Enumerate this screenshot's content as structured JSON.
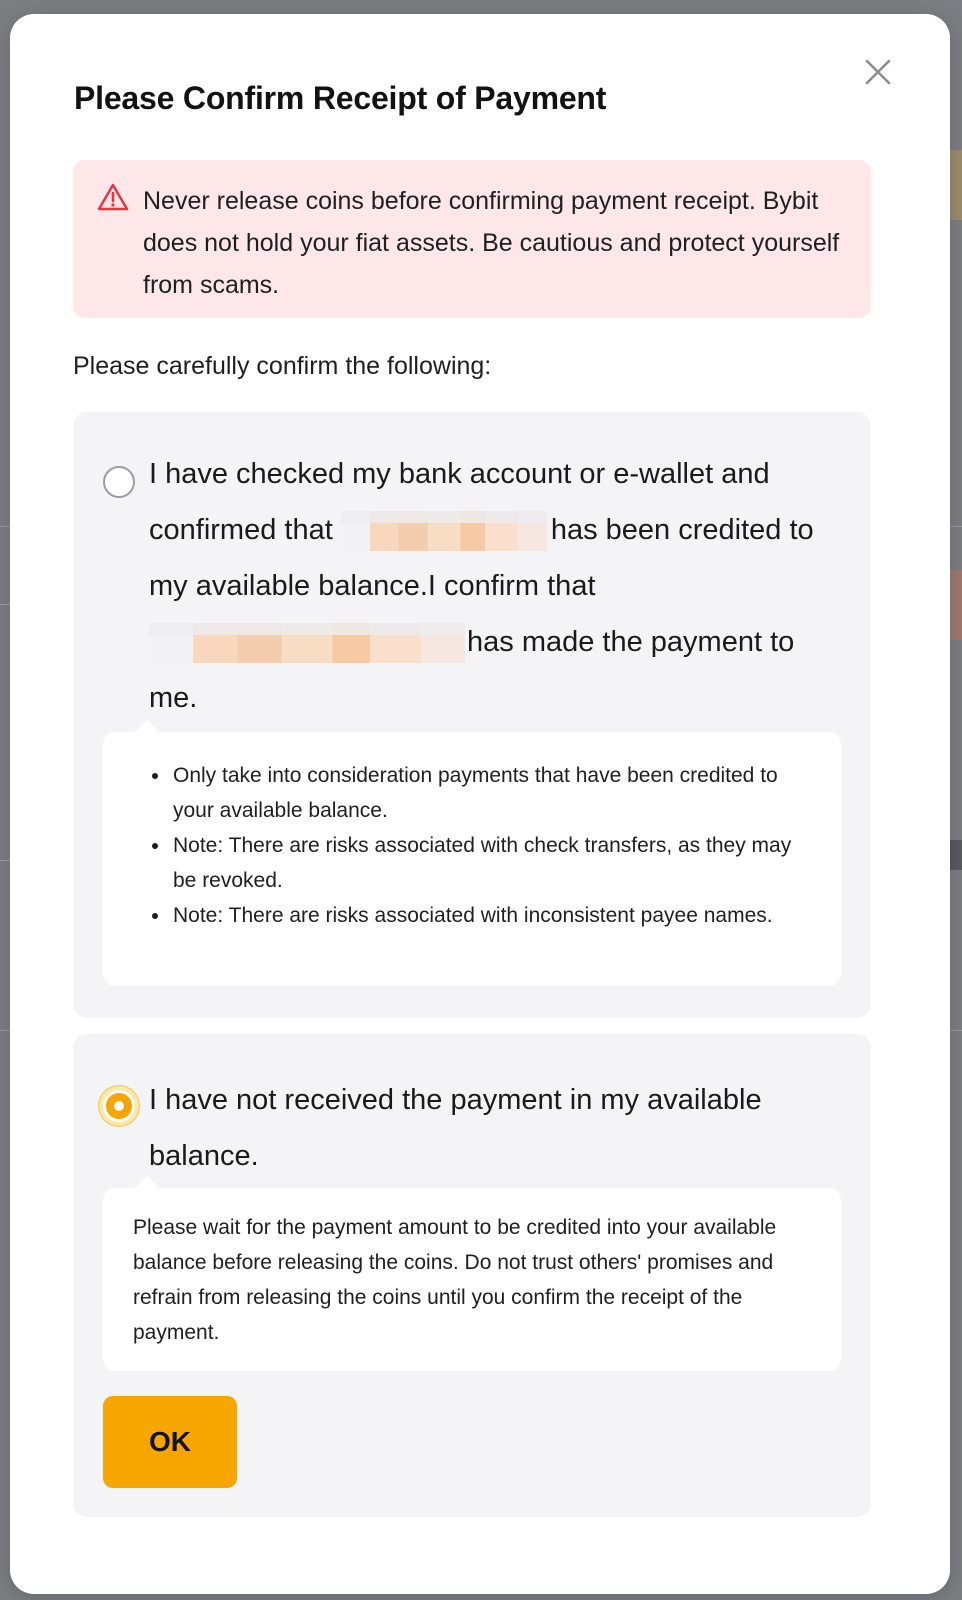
{
  "modal": {
    "title": "Please Confirm Receipt of Payment",
    "close_icon": "close-icon",
    "warning": {
      "icon": "warning-triangle-icon",
      "icon_color": "#e8343f",
      "background": "#fde7e8",
      "text": "Never release coins before confirming payment receipt. Bybit does not hold your fiat assets. Be cautious and protect yourself from scams."
    },
    "instruction": "Please carefully confirm the following:",
    "options": [
      {
        "selected": false,
        "text_part1": "I have checked my bank account or e-wallet and confirmed that",
        "text_part2": "has been credited to my available balance.I confirm that",
        "text_part3": "has made the payment to me.",
        "notes": [
          "Only take into consideration payments that have been credited to your available balance.",
          "Note: There are risks associated with check transfers, as they may be revoked.",
          "Note: There are risks associated with inconsistent payee names."
        ]
      },
      {
        "selected": true,
        "text": "I have not received the payment in my available balance.",
        "note": "Please wait for the payment amount to be credited into your available balance before releasing the coins. Do not trust others' promises and refrain from releasing the coins until you confirm the receipt of the payment.",
        "button_label": "OK"
      }
    ],
    "accent_color": "#f7a600"
  }
}
